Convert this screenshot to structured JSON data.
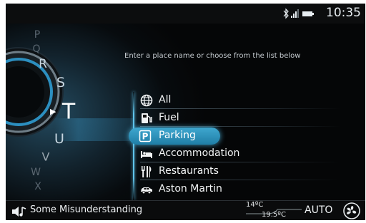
{
  "status": {
    "time": "10:35",
    "icons": [
      "bluetooth-icon",
      "signal-icon",
      "battery-icon"
    ]
  },
  "prompt": "Enter a place name or choose from the list below",
  "dial": {
    "letters": [
      "P",
      "Q",
      "R",
      "S",
      "T",
      "U",
      "V",
      "W",
      "X"
    ],
    "selected": "T"
  },
  "categories": [
    {
      "label": "All",
      "icon": "globe-icon"
    },
    {
      "label": "Fuel",
      "icon": "fuel-pump-icon"
    },
    {
      "label": "Parking",
      "icon": "parking-icon",
      "selected": true
    },
    {
      "label": "Accommodation",
      "icon": "bed-icon"
    },
    {
      "label": "Restaurants",
      "icon": "cutlery-icon"
    },
    {
      "label": "Aston Martin",
      "icon": "car-icon"
    }
  ],
  "media": {
    "track": "Some Misunderstanding",
    "icon": "music-note-icon"
  },
  "climate": {
    "temp_left": "14ºC",
    "temp_right": "19.5ºC",
    "mode": "AUTO",
    "fan_icon": "fan-icon"
  },
  "colors": {
    "accent": "#3fa7cf",
    "background": "#000000",
    "text": "#f2f4f5"
  }
}
